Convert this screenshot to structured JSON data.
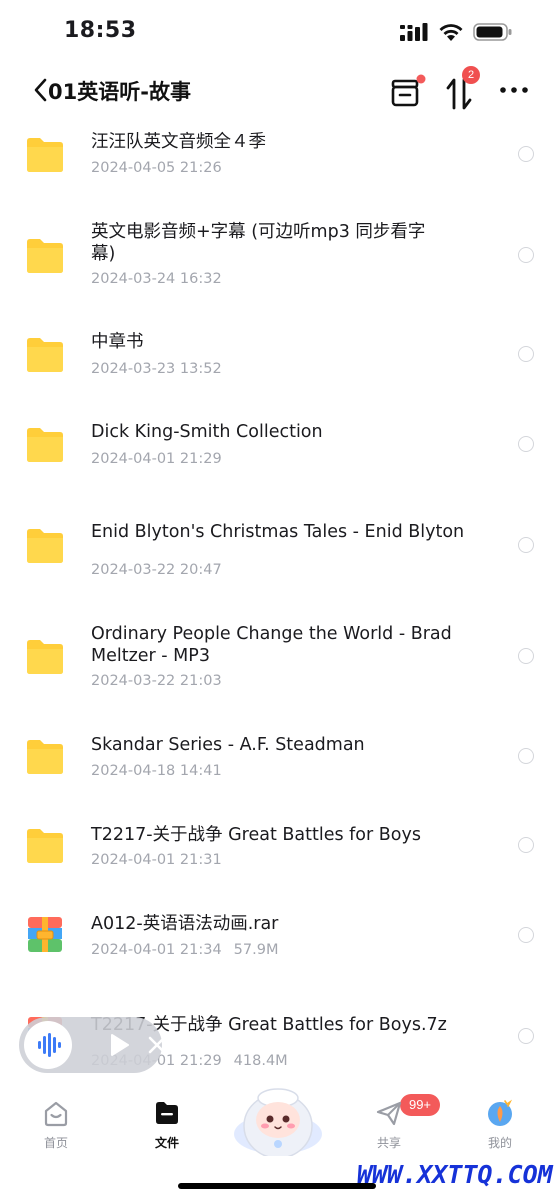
{
  "status_bar": {
    "time": "18:53"
  },
  "nav": {
    "title": "01英语听-故事",
    "sort_badge": "2"
  },
  "files": [
    {
      "name": "汪汪队英文音频全４季",
      "meta": "2024-04-05 21:26",
      "size": "",
      "type": "folder"
    },
    {
      "name": "英文电影音频+字幕 (可边听mp3 同步看字幕)",
      "meta": "2024-03-24 16:32",
      "size": "",
      "type": "folder"
    },
    {
      "name": "中章书",
      "meta": "2024-03-23 13:52",
      "size": "",
      "type": "folder"
    },
    {
      "name": "Dick King-Smith Collection",
      "meta": "2024-04-01 21:29",
      "size": "",
      "type": "folder"
    },
    {
      "name": "Enid Blyton's Christmas Tales - Enid Blyton",
      "meta": "2024-03-22 20:47",
      "size": "",
      "type": "folder"
    },
    {
      "name": "Ordinary People Change the World - Brad Meltzer - MP3",
      "meta": "2024-03-22 21:03",
      "size": "",
      "type": "folder"
    },
    {
      "name": "Skandar Series - A.F. Steadman",
      "meta": "2024-04-18 14:41",
      "size": "",
      "type": "folder"
    },
    {
      "name": "T2217-关于战争 Great Battles for Boys",
      "meta": "2024-04-01 21:31",
      "size": "",
      "type": "folder"
    },
    {
      "name": "A012-英语语法动画.rar",
      "meta": "2024-04-01 21:34",
      "size": "57.9M",
      "type": "archive"
    },
    {
      "name": "T2217-关于战争 Great Battles for Boys.7z",
      "meta": "2024-04-01 21:29",
      "size": "418.4M",
      "type": "archive"
    }
  ],
  "tabs": [
    {
      "label": "首页",
      "icon": "home-icon"
    },
    {
      "label": "文件",
      "icon": "folder-icon"
    },
    {
      "label": "共享",
      "icon": "share-icon"
    },
    {
      "label": "我的",
      "icon": "profile-icon"
    }
  ],
  "share_badge": "99+",
  "watermark": "WWW.XXTTQ.COM",
  "colors": {
    "folder": "#ffce3a",
    "badge": "#f35a5a",
    "meta": "#a3a6ae"
  }
}
